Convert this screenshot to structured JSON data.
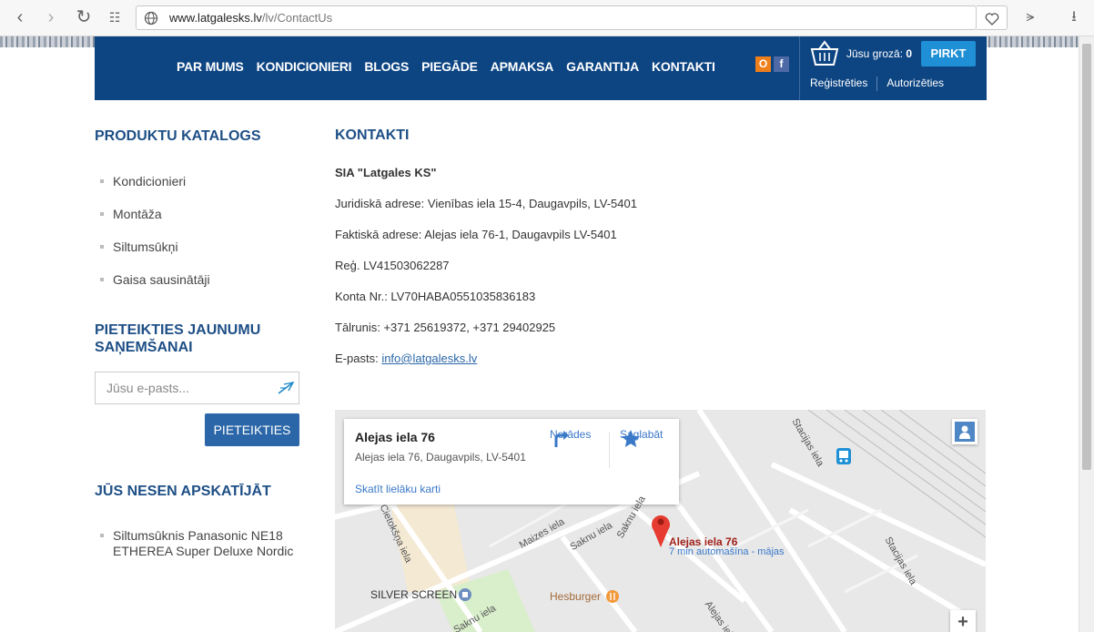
{
  "browser": {
    "url_host": "www.latgalesks.lv",
    "url_path": "/lv/ContactUs"
  },
  "header": {
    "nav": [
      "PAR MUMS",
      "KONDICIONIERI",
      "BLOGS",
      "PIEGĀDE",
      "APMAKSA",
      "GARANTIJA",
      "KONTAKTI"
    ],
    "social": {
      "odnoklassniki": "О",
      "facebook": "f"
    },
    "cart_label": "Jūsu grozā:",
    "cart_count": "0",
    "buy_label": "PIRKT",
    "register": "Reģistrēties",
    "login": "Autorizēties"
  },
  "sidebar": {
    "catalog_title": "PRODUKTU KATALOGS",
    "catalog_items": [
      "Kondicionieri",
      "Montāža",
      "Siltumsūkņi",
      "Gaisa sausinātāji"
    ],
    "newsletter_title_1": "PIETEIKTIES JAUNUMU",
    "newsletter_title_2": "SAŅEMŠANAI",
    "email_placeholder": "Jūsu e-pasts...",
    "subscribe_label": "PIETEIKTIES",
    "recent_title": "JŪS NESEN APSKATĪJĀT",
    "recent_line_1": "Siltumsūknis Panasonic NE18",
    "recent_line_2": "ETHEREA Super Deluxe Nordic"
  },
  "content": {
    "title": "KONTAKTI",
    "company": "SIA \"Latgales KS\"",
    "legal_address": "Juridiskā adrese: Vienības iela 15-4, Daugavpils, LV-5401",
    "actual_address": "Faktiskā adrese: Alejas iela 76-1, Daugavpils LV-5401",
    "reg": "Reģ. LV41503062287",
    "account": "Konta Nr.: LV70HABA0551035836183",
    "phone": "Tālrunis: +371 25619372, +371 29402925",
    "email_label": "E-pasts:",
    "email": "info@latgalesks.lv"
  },
  "map": {
    "card_name": "Alejas iela 76",
    "card_address": "Alejas iela 76, Daugavpils, LV-5401",
    "directions": "Norādes",
    "save": "Saglabāt",
    "larger_map": "Skatīt lielāku karti",
    "pin_title": "Alejas iela 76",
    "pin_subtitle": "7 min automašīna - mājas",
    "place_cinema": "SILVER SCREEN",
    "place_burger": "Hesburger",
    "streets": [
      "Stacijas iela",
      "Stacijas iela",
      "Cietokšņa iela",
      "Maizes iela",
      "Saknu iela",
      "Saknu iela",
      "Saknu iela",
      "Alejas iela"
    ],
    "zoom_in": "+"
  }
}
